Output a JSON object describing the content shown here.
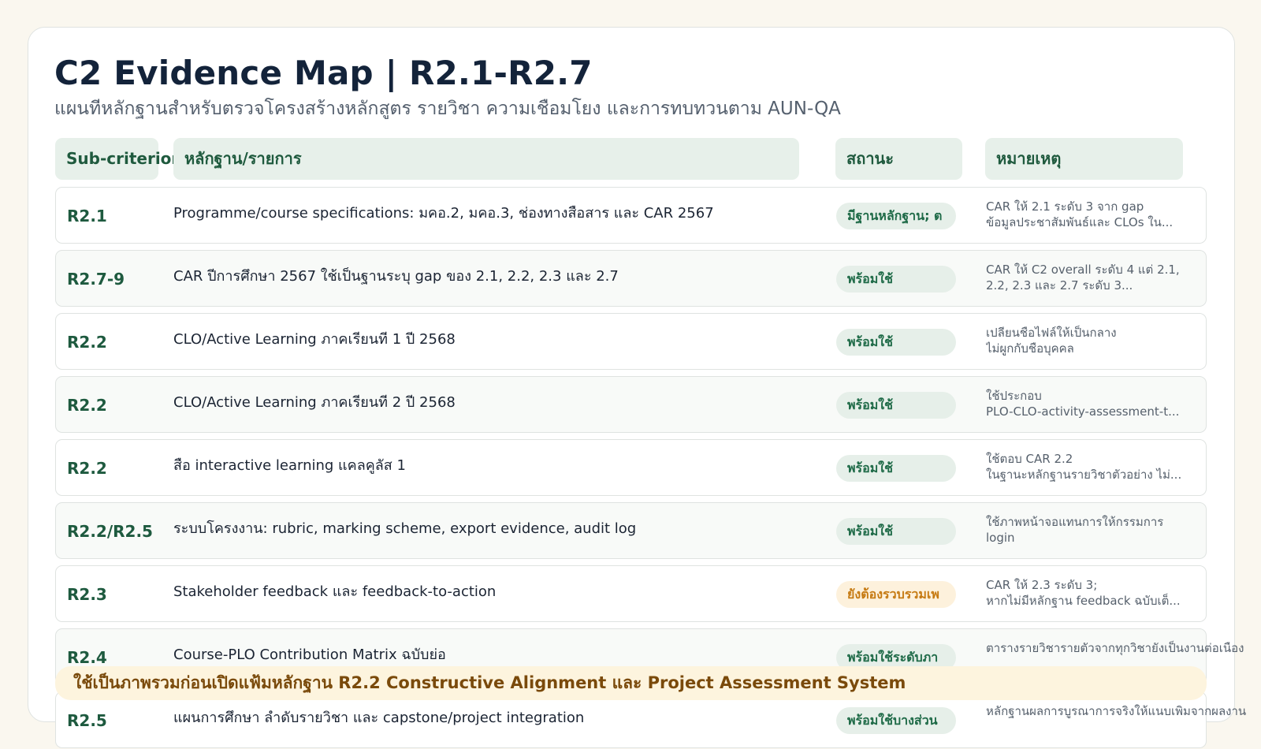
{
  "title": "C2 Evidence Map | R2.1-R2.7",
  "subtitle": "แผนทีหลักฐานสำหรับตรวจโครงสร้างหลักสูตร รายวิชา ความเชือมโยง และการทบทวนตาม AUN-QA",
  "columns": {
    "sub_criterion": "Sub-criterion",
    "evidence": "หลักฐาน/รายการ",
    "status": "สถานะ",
    "note": "หมายเหตุ"
  },
  "rows": [
    {
      "code": "R2.1",
      "item": "Programme/course specifications: มคอ.2, มคอ.3, ช่องทางสือสาร และ CAR 2567",
      "status": "มีฐานหลักฐาน; ต",
      "status_type": "ok",
      "note1": "CAR ให้ 2.1 ระดับ 3 จาก gap",
      "note2": "ข้อมูลประชาสัมพันธ์และ CLOs ใน..."
    },
    {
      "code": "R2.7-9",
      "item": "CAR ปีการศึกษา 2567 ใช้เป็นฐานระบุ gap ของ 2.1, 2.2, 2.3 และ 2.7",
      "status": "พร้อมใช้",
      "status_type": "ok",
      "note1": "CAR ให้ C2 overall ระดับ 4 แต่ 2.1,",
      "note2": "2.2, 2.3 และ 2.7 ระดับ 3..."
    },
    {
      "code": "R2.2",
      "item": "CLO/Active Learning ภาคเรียนที 1 ปี 2568",
      "status": "พร้อมใช้",
      "status_type": "ok",
      "note1": "เปลียนชือไฟล์ให้เป็นกลาง",
      "note2": "ไม่ผูกกับชือบุคคล"
    },
    {
      "code": "R2.2",
      "item": "CLO/Active Learning ภาคเรียนที 2 ปี 2568",
      "status": "พร้อมใช้",
      "status_type": "ok",
      "note1": "ใช้ประกอบ",
      "note2": "PLO-CLO-activity-assessment-t..."
    },
    {
      "code": "R2.2",
      "item": "สือ interactive learning แคลคูลัส 1",
      "status": "พร้อมใช้",
      "status_type": "ok",
      "note1": "ใช้ตอบ CAR 2.2",
      "note2": "ในฐานะหลักฐานรายวิชาตัวอย่าง ไม่..."
    },
    {
      "code": "R2.2/R2.5",
      "item": "ระบบโครงงาน: rubric, marking scheme, export evidence, audit log",
      "status": "พร้อมใช้",
      "status_type": "ok",
      "note1": "ใช้ภาพหน้าจอแทนการให้กรรมการ",
      "note2": "login"
    },
    {
      "code": "R2.3",
      "item": "Stakeholder feedback และ feedback-to-action",
      "status": "ยังต้องรวบรวมเพ",
      "status_type": "warn",
      "note1": "CAR ให้ 2.3 ระดับ 3;",
      "note2": "หากไม่มีหลักฐาน feedback ฉบับเต็..."
    },
    {
      "code": "R2.4",
      "item": "Course-PLO Contribution Matrix ฉบับย่อ",
      "status": "พร้อมใช้ระดับภา",
      "status_type": "ok",
      "note1": "ตารางรายวิชารายตัวจากทุกวิชายังเป็นงานต่อเนือง",
      "note2": ""
    },
    {
      "code": "R2.5",
      "item": "แผนการศึกษา ลำดับรายวิชา และ capstone/project integration",
      "status": "พร้อมใช้บางส่วน",
      "status_type": "ok",
      "note1": "หลักฐานผลการบูรณาการจริงให้แนบเพิมจากผลงาน/รา",
      "note2": ""
    }
  ],
  "banner": "ใช้เป็นภาพรวมก่อนเปิดแฟ้มหลักฐาน R2.2 Constructive Alignment และ Project Assessment System",
  "colors": {
    "background": "#faf7ef",
    "header_fill": "#e7f0ea",
    "accent_green": "#1e5a3f",
    "warn_fill": "#fdf1dc",
    "warn_text": "#c67a12",
    "banner_fill": "#fdf4de"
  }
}
